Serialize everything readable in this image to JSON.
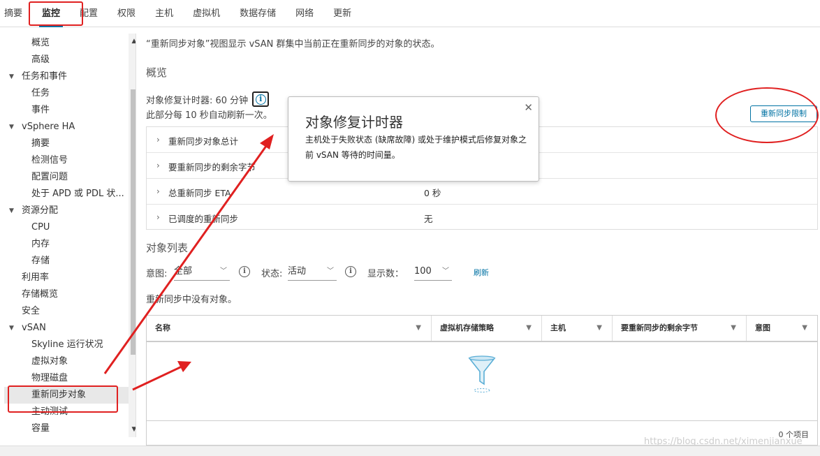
{
  "tabs": [
    {
      "label": "摘要"
    },
    {
      "label": "监控"
    },
    {
      "label": "配置"
    },
    {
      "label": "权限"
    },
    {
      "label": "主机"
    },
    {
      "label": "虚拟机"
    },
    {
      "label": "数据存储"
    },
    {
      "label": "网络"
    },
    {
      "label": "更新"
    }
  ],
  "sidebar": {
    "items": [
      {
        "label": "概览"
      },
      {
        "label": "高级"
      },
      {
        "label": "任务和事件"
      },
      {
        "label": "任务"
      },
      {
        "label": "事件"
      },
      {
        "label": "vSphere HA"
      },
      {
        "label": "摘要"
      },
      {
        "label": "检测信号"
      },
      {
        "label": "配置问题"
      },
      {
        "label": "处于 APD 或 PDL 状..."
      },
      {
        "label": "资源分配"
      },
      {
        "label": "CPU"
      },
      {
        "label": "内存"
      },
      {
        "label": "存储"
      },
      {
        "label": "利用率"
      },
      {
        "label": "存储概览"
      },
      {
        "label": "安全"
      },
      {
        "label": "vSAN"
      },
      {
        "label": "Skyline 运行状况"
      },
      {
        "label": "虚拟对象"
      },
      {
        "label": "物理磁盘"
      },
      {
        "label": "重新同步对象"
      },
      {
        "label": "主动测试"
      },
      {
        "label": "容量"
      }
    ]
  },
  "main": {
    "description": "“重新同步对象”视图显示 vSAN 群集中当前正在重新同步的对象的状态。",
    "overview_title": "概览",
    "timer_label": "对象修复计时器: 60 分钟",
    "refresh_note": "此部分每 10 秒自动刷新一次。",
    "resync_limit_button": "重新同步限制",
    "summary_rows": [
      {
        "label": "重新同步对象总计",
        "value": ""
      },
      {
        "label": "要重新同步的剩余字节",
        "value": ""
      },
      {
        "label": "总重新同步 ETA",
        "value": "0 秒"
      },
      {
        "label": "已调度的重新同步",
        "value": "无"
      }
    ],
    "tooltip": {
      "title": "对象修复计时器",
      "body": "主机处于失败状态 (缺席故障) 或处于维护模式后修复对象之前 vSAN 等待的时间量。"
    },
    "object_list_title": "对象列表",
    "filters": {
      "intent_label": "意图:",
      "intent_value": "全部",
      "status_label": "状态:",
      "status_value": "活动",
      "show_label": "显示数：",
      "show_value": "100",
      "refresh": "刷新"
    },
    "empty_message": "重新同步中没有对象。",
    "grid": {
      "columns": [
        "名称",
        "虚拟机存储策略",
        "主机",
        "要重新同步的剩余字节",
        "意图"
      ],
      "footer": "0 个项目"
    }
  },
  "watermark": "https://blog.csdn.net/ximenjianxue",
  "colors": {
    "accent": "#0072a3",
    "annotation": "#e02020"
  }
}
